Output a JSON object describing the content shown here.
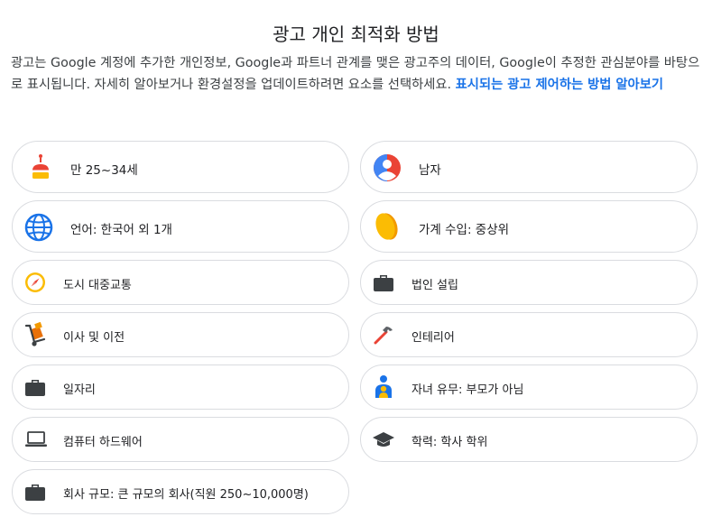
{
  "page": {
    "title": "광고 개인 최적화 방법",
    "description": "광고는 Google 계정에 추가한 개인정보, Google과 파트너 관계를 맺은 광고주의 데이터, Google이 추정한 관심분야를 바탕으로 표시됩니다. 자세히 알아보거나 환경설정을 업데이트하려면 요소를 선택하세요.",
    "link_text": "표시되는 광고 제어하는 방법 알아보기"
  },
  "cards": [
    {
      "label": "만 25~34세",
      "icon": "birthday-cake-icon"
    },
    {
      "label": "남자",
      "icon": "person-avatar-icon"
    },
    {
      "label": "언어: 한국어 외 1개",
      "icon": "globe-icon"
    },
    {
      "label": "가계 수입: 중상위",
      "icon": "coin-icon"
    },
    {
      "label": "도시 대중교통",
      "icon": "compass-icon"
    },
    {
      "label": "법인 설립",
      "icon": "briefcase-icon"
    },
    {
      "label": "이사 및 이전",
      "icon": "hand-truck-icon"
    },
    {
      "label": "인테리어",
      "icon": "hammer-icon"
    },
    {
      "label": "일자리",
      "icon": "briefcase-icon"
    },
    {
      "label": "자녀 유무: 부모가 아님",
      "icon": "parent-child-icon"
    },
    {
      "label": "컴퓨터 하드웨어",
      "icon": "laptop-icon"
    },
    {
      "label": "학력: 학사 학위",
      "icon": "graduation-cap-icon"
    },
    {
      "label": "회사 규모: 큰 규모의 회사(직원 250~10,000명)",
      "icon": "briefcase-icon"
    }
  ],
  "colors": {
    "link": "#1a73e8",
    "border": "#dadce0",
    "icon_dark": "#3c4043"
  }
}
